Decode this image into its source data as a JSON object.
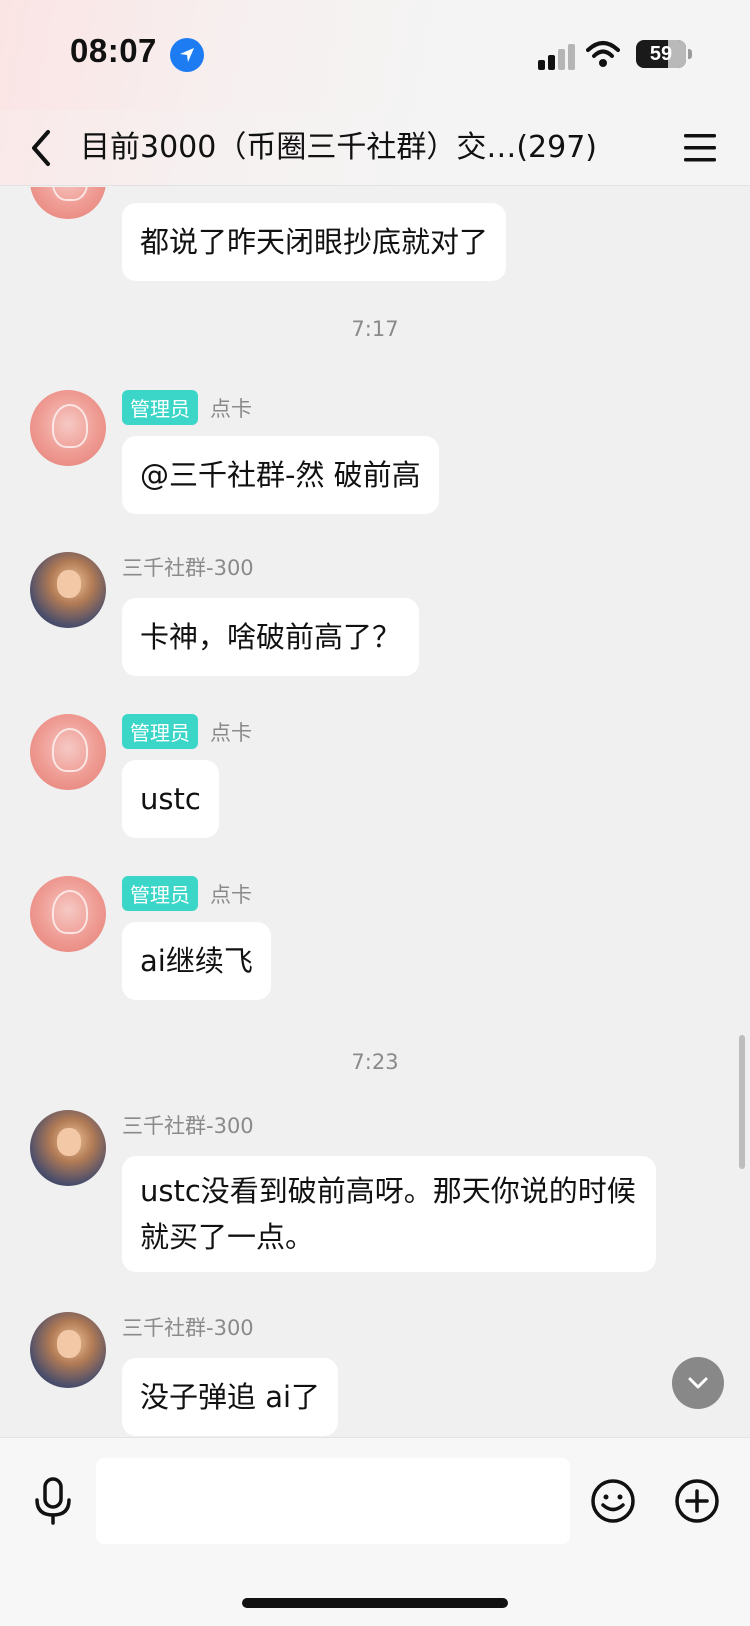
{
  "status_bar": {
    "time": "08:07",
    "battery": "59",
    "icons": [
      "location-arrow-icon",
      "cellular-signal-icon",
      "wifi-icon",
      "battery-icon"
    ]
  },
  "header": {
    "title": "目前3000（币圈三千社群）交…(297)",
    "icons": [
      "chevron-left-icon",
      "hamburger-menu-icon"
    ]
  },
  "messages": {
    "m0": {
      "text": "都说了昨天闭眼抄底就对了"
    },
    "t1": "7:17",
    "m1": {
      "tag": "管理员",
      "name": "点卡",
      "text": "@三千社群-然 破前高"
    },
    "m2": {
      "name": "三千社群-300",
      "text": "卡神，啥破前高了？"
    },
    "m3": {
      "tag": "管理员",
      "name": "点卡",
      "text": "ustc"
    },
    "m4": {
      "tag": "管理员",
      "name": "点卡",
      "text": "ai继续飞"
    },
    "t2": "7:23",
    "m5": {
      "name": "三千社群-300",
      "text": "ustc没看到破前高呀。那天你说的时候就买了一点。"
    },
    "m6": {
      "name": "三千社群-300",
      "text": "没子弹追 ai了"
    }
  },
  "input_bar": {
    "value": "",
    "icons": [
      "microphone-icon",
      "emoji-icon",
      "plus-circle-icon"
    ]
  },
  "colors": {
    "admin_tag": "#3cd6c9",
    "bubble": "#ffffff",
    "background": "#f0f0f0",
    "location_icon": "#1e7cf2"
  }
}
